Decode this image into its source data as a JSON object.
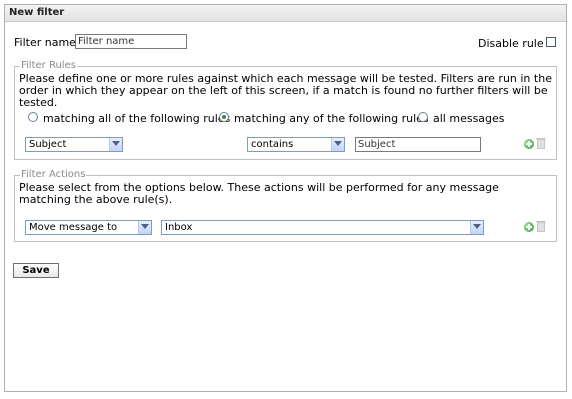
{
  "window": {
    "title": "New filter"
  },
  "filter_name": {
    "label": "Filter name",
    "placeholder": "Filter name",
    "value": ""
  },
  "disable_rule": {
    "label": "Disable rule",
    "checked": false
  },
  "filter_rules": {
    "legend": "Filter Rules",
    "description": "Please define one or more rules against which each message will be tested. Filters are run in the order in which they appear on the left of this screen, if a match is found no further filters will be tested.",
    "options": [
      {
        "label": "matching all of the following rules",
        "checked": false
      },
      {
        "label": "matching any of the following rules",
        "checked": true
      },
      {
        "label": "all messages",
        "checked": false
      }
    ],
    "rule": {
      "field": "Subject",
      "operator": "contains",
      "value": "Subject"
    }
  },
  "filter_actions": {
    "legend": "Filter Actions",
    "description": "Please select from the options below. These actions will be performed for any message matching the above rule(s).",
    "action": {
      "type": "Move message to",
      "target": "Inbox"
    }
  },
  "save_label": "Save"
}
